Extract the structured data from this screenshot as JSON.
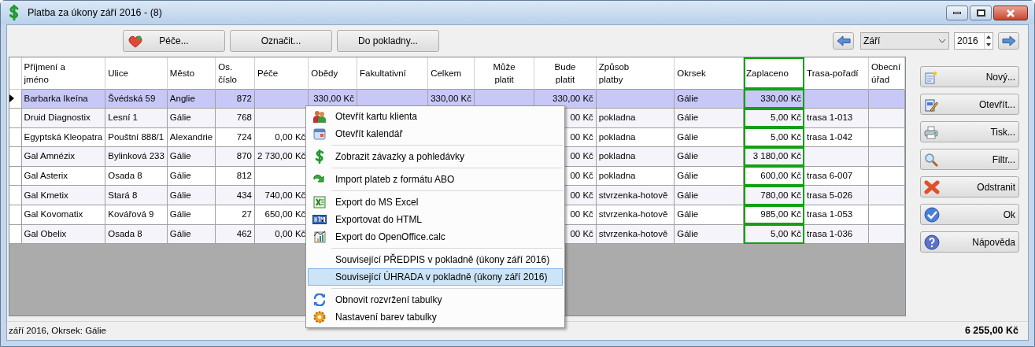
{
  "window": {
    "title": "Platba za úkony září 2016 - (8)"
  },
  "toolbar": {
    "buttons": [
      "Péče...",
      "Označit...",
      "Do pokladny..."
    ],
    "month": "Září",
    "year": "2016"
  },
  "table": {
    "columns": [
      {
        "label": "Příjmení a\njméno",
        "highlighted": false
      },
      {
        "label": "Ulice",
        "highlighted": false
      },
      {
        "label": "Město",
        "highlighted": false
      },
      {
        "label": "Os. číslo",
        "highlighted": false
      },
      {
        "label": "Péče",
        "highlighted": false
      },
      {
        "label": "Obědy",
        "highlighted": false
      },
      {
        "label": "Fakultativní",
        "highlighted": false
      },
      {
        "label": "Celkem",
        "highlighted": false
      },
      {
        "label": "Může\nplatit",
        "highlighted": false
      },
      {
        "label": "Bude\nplatit",
        "highlighted": false
      },
      {
        "label": "Způsob\nplatby",
        "highlighted": false
      },
      {
        "label": "Okrsek",
        "highlighted": false
      },
      {
        "label": "Zaplaceno",
        "highlighted": true
      },
      {
        "label": "Trasa-pořadí",
        "highlighted": false
      },
      {
        "label": "Obecní\núřad",
        "highlighted": false
      }
    ],
    "rows": [
      {
        "selected": true,
        "cells": [
          "Barbarka Ikeína",
          "Švédská 59",
          "Anglie",
          "872",
          null,
          "330,00 Kč",
          null,
          "330,00 Kč",
          null,
          "330,00 Kč",
          null,
          "Gálie",
          "330,00 Kč",
          null,
          null
        ]
      },
      {
        "selected": false,
        "cells": [
          "Druid Diagnostix",
          "Lesní 1",
          "Gálie",
          "768",
          null,
          null,
          null,
          null,
          null,
          "00 Kč",
          "pokladna",
          "Gálie",
          "5,00 Kč",
          "trasa 1-013",
          null
        ]
      },
      {
        "selected": false,
        "cells": [
          "Egyptská Kleopatra",
          "Pouštní 888/1",
          "Alexandrie",
          "724",
          "0,00 Kč",
          null,
          null,
          null,
          null,
          "00 Kč",
          "pokladna",
          "Gálie",
          "5,00 Kč",
          "trasa 1-042",
          null
        ]
      },
      {
        "selected": false,
        "cells": [
          "Gal Amnézix",
          "Bylinková 233",
          "Gálie",
          "870",
          "2 730,00 Kč",
          null,
          null,
          null,
          null,
          "00 Kč",
          "pokladna",
          "Gálie",
          "3 180,00 Kč",
          null,
          null
        ]
      },
      {
        "selected": false,
        "cells": [
          "Gal Asterix",
          "Osada 8",
          "Gálie",
          "812",
          null,
          null,
          null,
          null,
          null,
          "00 Kč",
          "pokladna",
          "Gálie",
          "600,00 Kč",
          "trasa 6-007",
          null
        ]
      },
      {
        "selected": false,
        "cells": [
          "Gal Kmetix",
          "Stará 8",
          "Gálie",
          "434",
          "740,00 Kč",
          null,
          null,
          null,
          null,
          "00 Kč",
          "stvrzenka-hotově",
          "Gálie",
          "780,00 Kč",
          "trasa 5-026",
          null
        ]
      },
      {
        "selected": false,
        "cells": [
          "Gal Kovomatix",
          "Kovářová 9",
          "Gálie",
          "27",
          "650,00 Kč",
          null,
          null,
          null,
          null,
          "00 Kč",
          "stvrzenka-hotově",
          "Gálie",
          "985,00 Kč",
          "trasa 1-053",
          null
        ]
      },
      {
        "selected": false,
        "cells": [
          "Gal Obelix",
          "Osada 8",
          "Gálie",
          "462",
          "0,00 Kč",
          null,
          null,
          null,
          null,
          "00 Kč",
          "stvrzenka-hotově",
          "Gálie",
          "5,00 Kč",
          "trasa 1-036",
          null
        ]
      }
    ]
  },
  "context_menu": {
    "groups": [
      [
        {
          "label": "Otevřít kartu klienta",
          "selected": false
        },
        {
          "label": "Otevřít kalendář",
          "selected": false
        }
      ],
      [
        {
          "label": "Zobrazit závazky a pohledávky",
          "selected": false
        }
      ],
      [
        {
          "label": "Import plateb z formátu ABO",
          "selected": false
        }
      ],
      [
        {
          "label": "Export do MS Excel",
          "selected": false
        },
        {
          "label": "Exportovat do HTML",
          "selected": false
        },
        {
          "label": "Export do OpenOffice.calc",
          "selected": false
        }
      ],
      [
        {
          "label": "Související PŘEDPIS v pokladně (úkony září 2016)",
          "selected": false
        },
        {
          "label": "Související ÚHRADA v pokladně (úkony září 2016)",
          "selected": true
        }
      ],
      [
        {
          "label": "Obnovit rozvržení tabulky",
          "selected": false
        },
        {
          "label": "Nastavení barev tabulky",
          "selected": false
        }
      ]
    ]
  },
  "side_buttons": [
    "Nový...",
    "Otevřít...",
    "Tisk...",
    "Filtr...",
    "Odstranit",
    "Ok",
    "Nápověda"
  ],
  "status_bar": {
    "text": "září 2016, Okrsek: Gálie",
    "total": "6 255,00 Kč"
  }
}
